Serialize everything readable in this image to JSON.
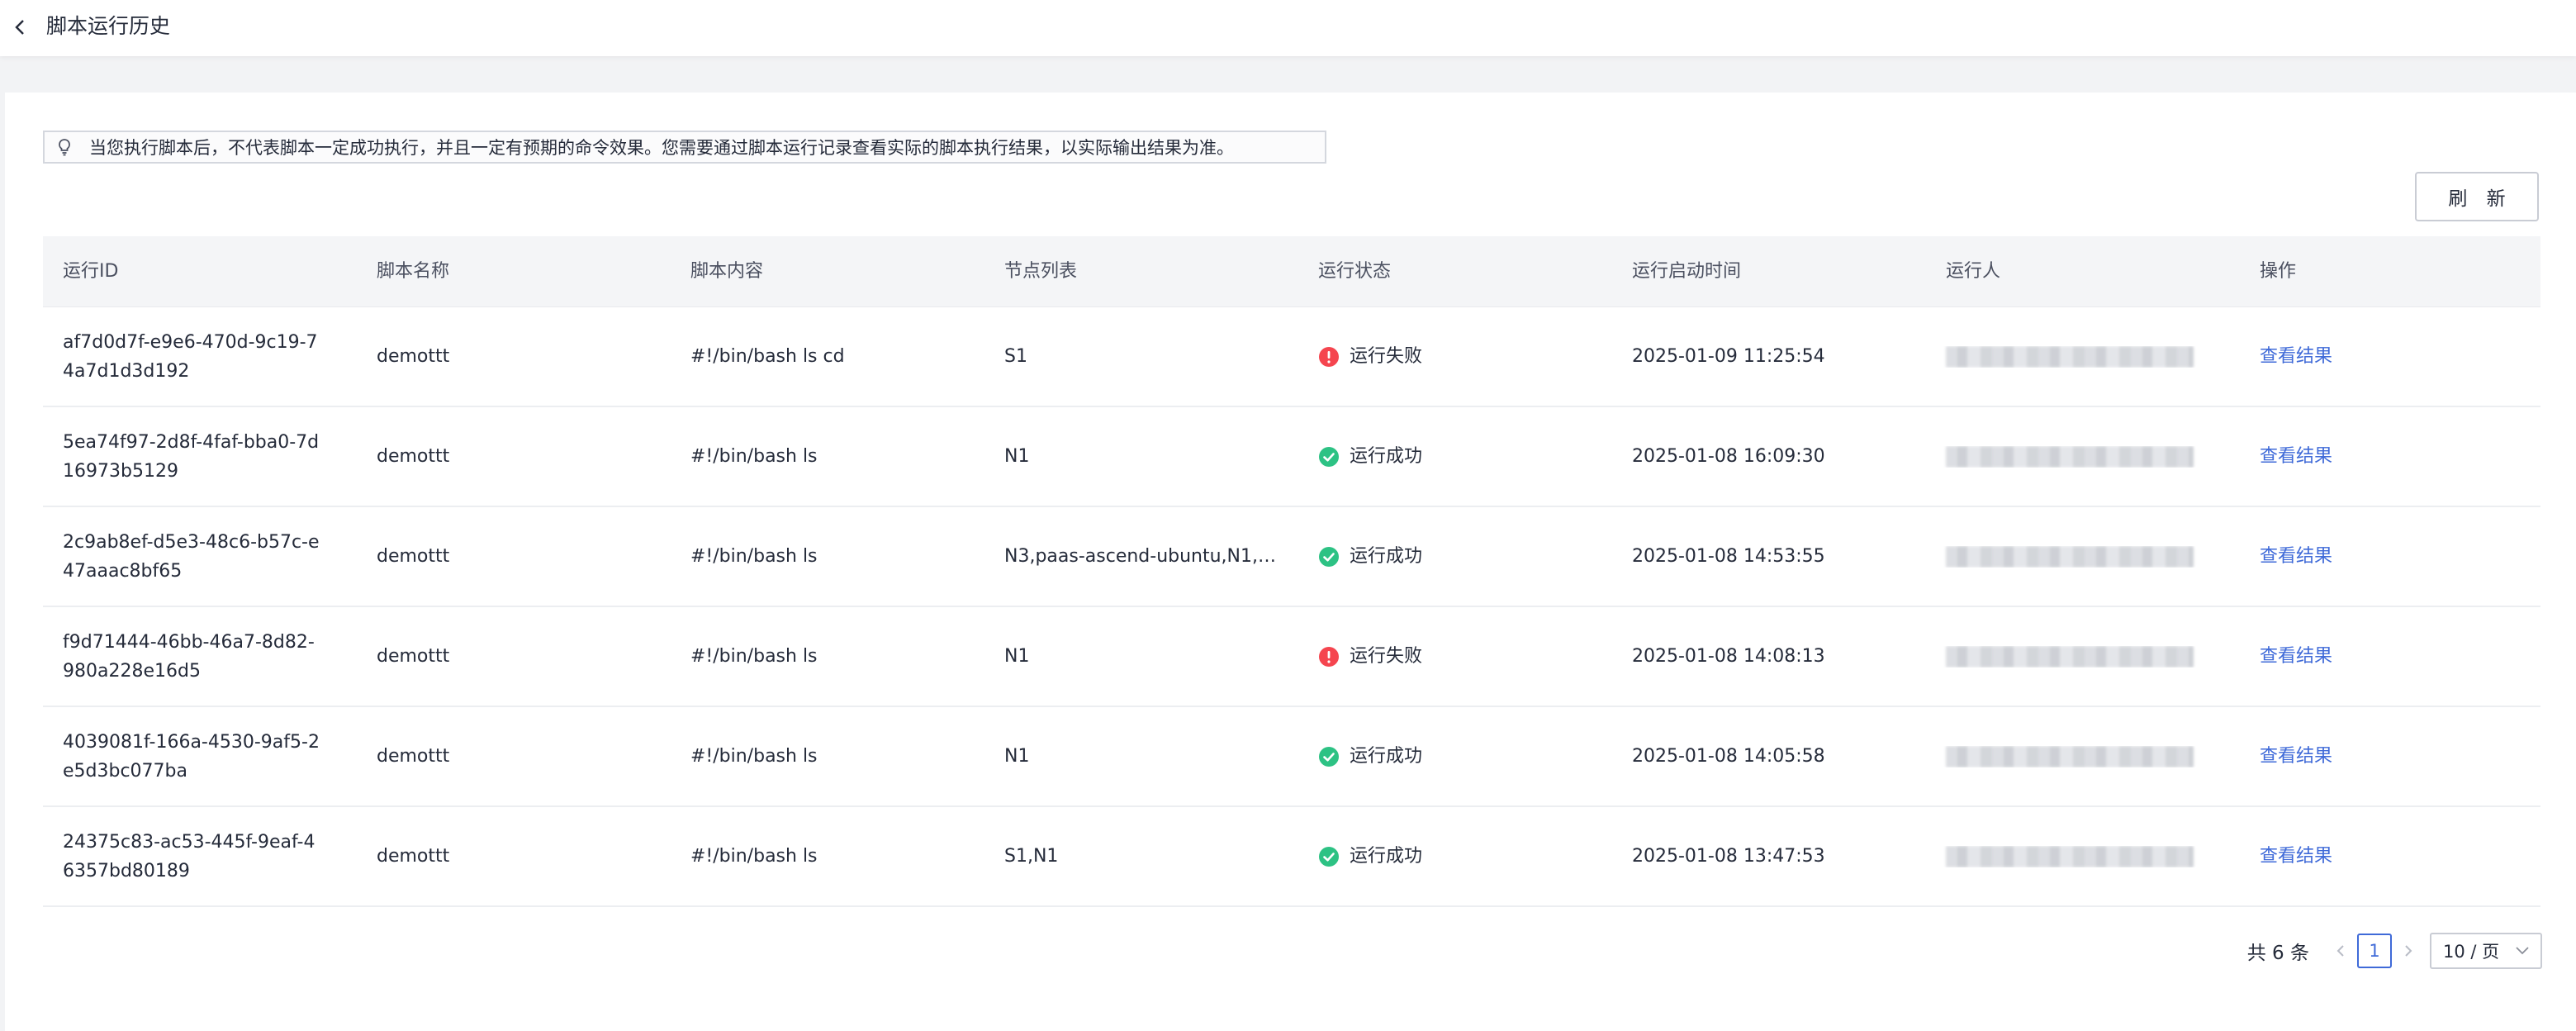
{
  "header": {
    "title": "脚本运行历史"
  },
  "notice": {
    "text": "当您执行脚本后，不代表脚本一定成功执行，并且一定有预期的命令效果。您需要通过脚本运行记录查看实际的脚本执行结果，以实际输出结果为准。"
  },
  "toolbar": {
    "refresh_label": "刷 新"
  },
  "table": {
    "columns": [
      "运行ID",
      "脚本名称",
      "脚本内容",
      "节点列表",
      "运行状态",
      "运行启动时间",
      "运行人",
      "操作"
    ],
    "rows": [
      {
        "id": "af7d0d7f-e9e6-470d-9c19-74a7d1d3d192",
        "name": "demottt",
        "content": "#!/bin/bash ls cd",
        "nodes": "S1",
        "status": "运行失败",
        "status_type": "fail",
        "time": "2025-01-09 11:25:54",
        "action": "查看结果"
      },
      {
        "id": "5ea74f97-2d8f-4faf-bba0-7d16973b5129",
        "name": "demottt",
        "content": "#!/bin/bash ls",
        "nodes": "N1",
        "status": "运行成功",
        "status_type": "success",
        "time": "2025-01-08 16:09:30",
        "action": "查看结果"
      },
      {
        "id": "2c9ab8ef-d5e3-48c6-b57c-e47aaac8bf65",
        "name": "demottt",
        "content": "#!/bin/bash ls",
        "nodes": "N3,paas-ascend-ubuntu,N1,pa...",
        "status": "运行成功",
        "status_type": "success",
        "time": "2025-01-08 14:53:55",
        "action": "查看结果"
      },
      {
        "id": "f9d71444-46bb-46a7-8d82-980a228e16d5",
        "name": "demottt",
        "content": "#!/bin/bash ls",
        "nodes": "N1",
        "status": "运行失败",
        "status_type": "fail",
        "time": "2025-01-08 14:08:13",
        "action": "查看结果"
      },
      {
        "id": "4039081f-166a-4530-9af5-2e5d3bc077ba",
        "name": "demottt",
        "content": "#!/bin/bash ls",
        "nodes": "N1",
        "status": "运行成功",
        "status_type": "success",
        "time": "2025-01-08 14:05:58",
        "action": "查看结果"
      },
      {
        "id": "24375c83-ac53-445f-9eaf-46357bd80189",
        "name": "demottt",
        "content": "#!/bin/bash ls",
        "nodes": "S1,N1",
        "status": "运行成功",
        "status_type": "success",
        "time": "2025-01-08 13:47:53",
        "action": "查看结果"
      }
    ]
  },
  "pagination": {
    "total_label": "共 6 条",
    "current_page": "1",
    "page_size": "10 / 页"
  },
  "colors": {
    "fail": "#f5454f",
    "success": "#2dc284",
    "link": "#3f6ad8"
  },
  "icons": {
    "back": "chevron-left-icon",
    "notice": "lightbulb-icon",
    "fail": "error-circle-icon",
    "success": "check-circle-icon"
  }
}
